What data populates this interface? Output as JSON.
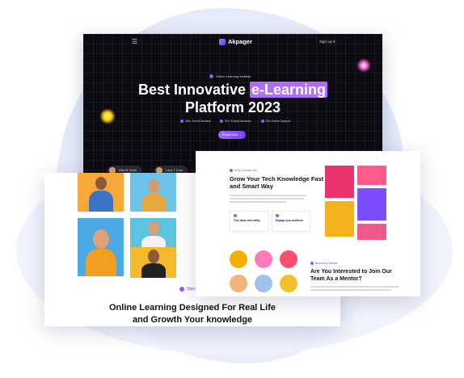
{
  "hero": {
    "logo": "Akpager",
    "signup": "Sign Up",
    "badge": "Online Learning Institute",
    "title_pre": "Best Innovative ",
    "title_highlight": "e-Learning",
    "title_line2": "Platform 2023",
    "features": [
      "36k+ Enroll Student",
      "50+ Expert Advisors",
      "24h Online Support"
    ],
    "cta": "Enroll Now",
    "instructors": [
      "Mike B. Smith",
      "Larry T. Coxe"
    ]
  },
  "left_card": {
    "section_tag": "Special Features",
    "title_line1": "Online Learning Designed For Real Life",
    "title_line2": "and Growth Your knowledge"
  },
  "right_card": {
    "tag": "Why Choose Us",
    "title": "Grow Your Tech Knowledge Fast and Smart Way",
    "boxes": [
      "Turn Ideas into reality",
      "Engage your audience"
    ],
    "mentor_tag": "Become A Mentor",
    "mentor_title": "Are You Interested to Join Our Team As a Mentor?"
  },
  "colors": {
    "accent": "#8b5cf6",
    "hero_bg": "#0b0b12",
    "highlight": "#b06cff"
  }
}
